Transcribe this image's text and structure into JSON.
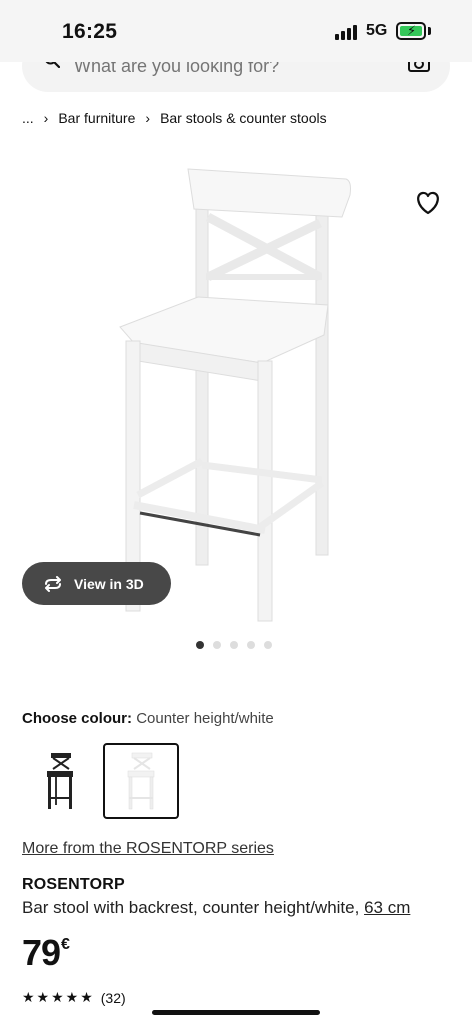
{
  "status_bar": {
    "time": "16:25",
    "network": "5G",
    "battery_icon": "battery-charging-icon"
  },
  "search": {
    "placeholder": "What are you looking for?"
  },
  "breadcrumb": {
    "ellipsis": "...",
    "items": [
      "Bar furniture",
      "Bar stools & counter stools"
    ]
  },
  "gallery": {
    "view_3d_label": "View in 3D",
    "image_count": 5,
    "active_index": 0
  },
  "colour": {
    "label": "Choose colour:",
    "selected": "Counter height/white"
  },
  "series_link": "More from the ROSENTORP series",
  "product": {
    "name": "ROSENTORP",
    "description": "Bar stool with backrest, counter height/white, ",
    "size": "63 cm",
    "price": "79",
    "currency": "€",
    "rating_value": 5,
    "rating_count": "(32)"
  },
  "colors": {
    "view3d_bg": "#484848",
    "accent": "#111111"
  }
}
